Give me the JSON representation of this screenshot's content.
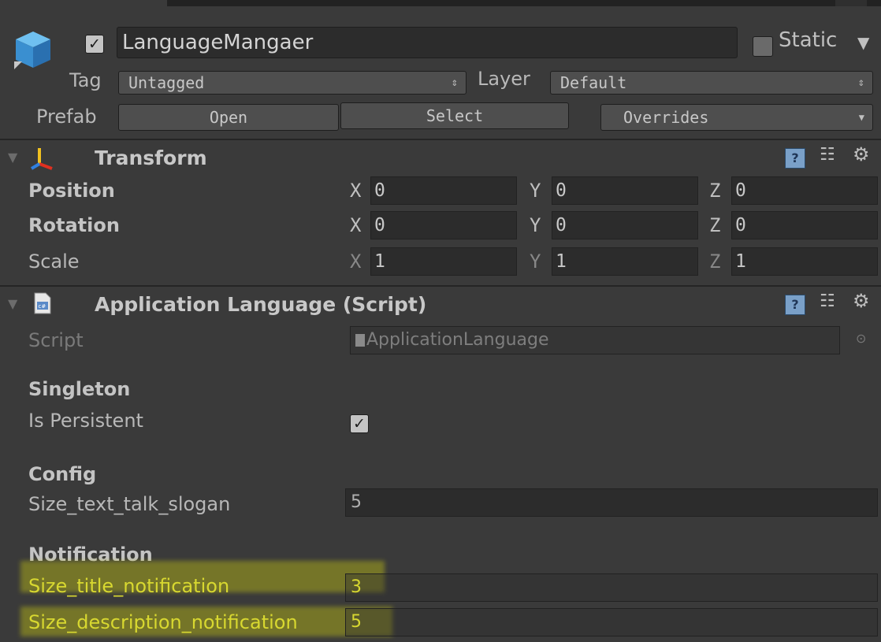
{
  "header": {
    "object_name": "LanguageMangaer",
    "active_checked": true,
    "static_label": "Static",
    "tag_label": "Tag",
    "tag_value": "Untagged",
    "layer_label": "Layer",
    "layer_value": "Default",
    "prefab_label": "Prefab",
    "open_label": "Open",
    "select_label": "Select",
    "overrides_label": "Overrides"
  },
  "transform": {
    "title": "Transform",
    "rows": [
      {
        "label": "Position",
        "x": "0",
        "y": "0",
        "z": "0"
      },
      {
        "label": "Rotation",
        "x": "0",
        "y": "0",
        "z": "0"
      },
      {
        "label": "Scale",
        "x": "1",
        "y": "1",
        "z": "1"
      }
    ],
    "axis_x": "X",
    "axis_y": "Y",
    "axis_z": "Z"
  },
  "script_component": {
    "title": "Application Language (Script)",
    "script_label": "Script",
    "script_value": "ApplicationLanguage",
    "singleton_header": "Singleton",
    "is_persistent_label": "Is Persistent",
    "is_persistent": true,
    "config_header": "Config",
    "size_text_talk_slogan_label": "Size_text_talk_slogan",
    "size_text_talk_slogan_value": "5",
    "notification_header": "Notification",
    "size_title_notification_label": "Size_title_notification",
    "size_title_notification_value": "3",
    "size_description_notification_label": "Size_description_notification",
    "size_description_notification_value": "5"
  },
  "icons": {
    "gameobject": "cube-icon",
    "transform": "transform-axes-icon",
    "script": "csharp-script-icon",
    "help": "help-book-icon",
    "preset": "preset-sliders-icon",
    "settings": "gear-icon"
  },
  "colors": {
    "background": "#3a3a3a",
    "field": "#2c2c2c",
    "highlight": "#bebe14",
    "highlight_text": "#d8d830"
  }
}
